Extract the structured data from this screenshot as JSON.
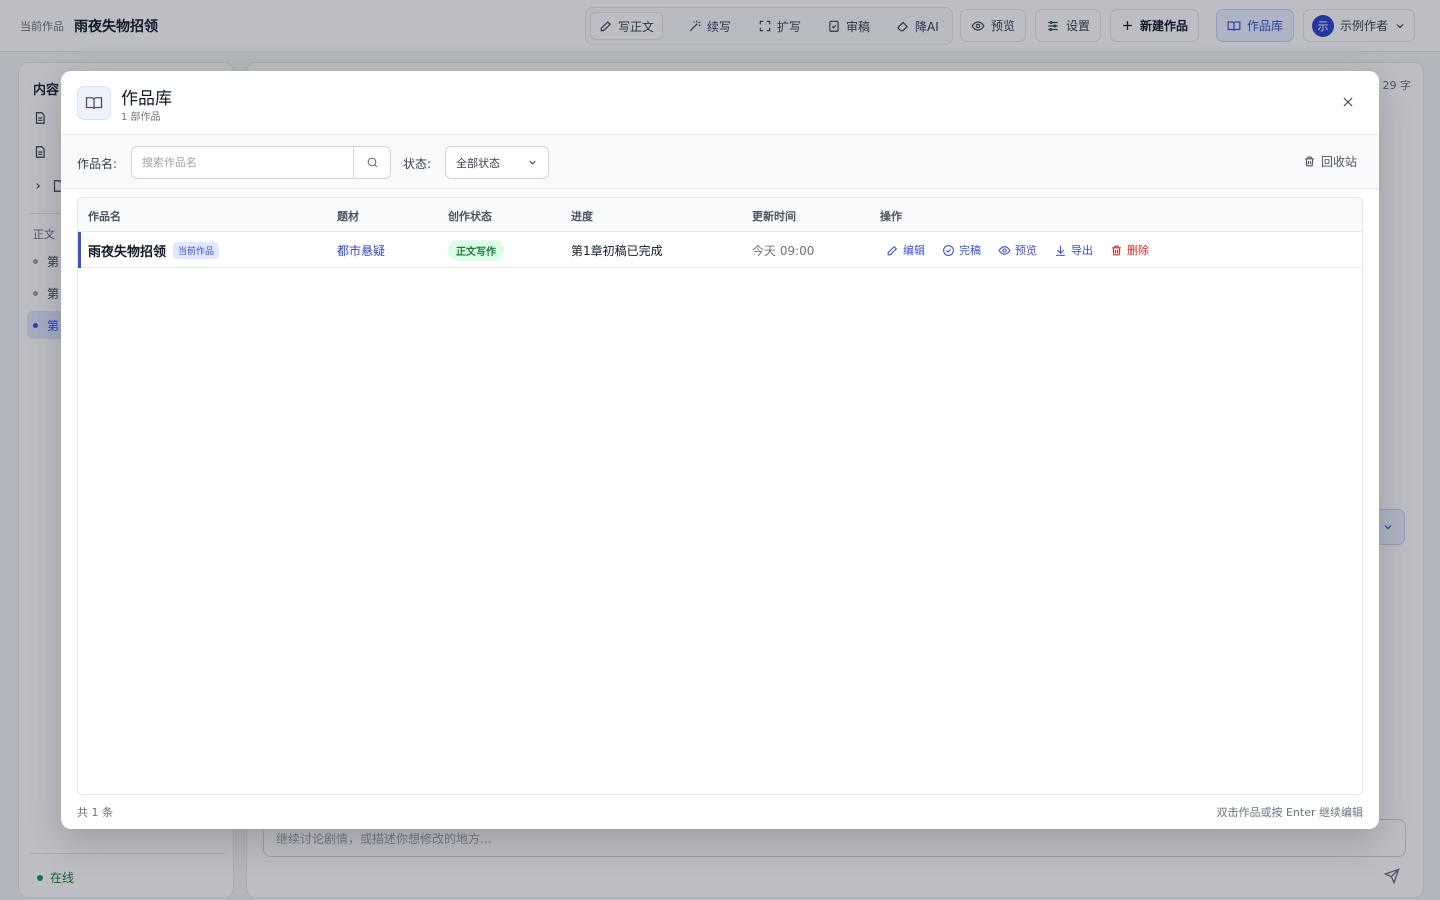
{
  "topbar": {
    "current_label": "当前作品",
    "current_title": "雨夜失物招领",
    "tools": [
      {
        "label": "写正文",
        "icon": "pencil-icon"
      },
      {
        "label": "续写",
        "icon": "magic-wand-icon"
      },
      {
        "label": "扩写",
        "icon": "expand-icon"
      },
      {
        "label": "审稿",
        "icon": "clipboard-check-icon"
      },
      {
        "label": "降AI",
        "icon": "eraser-icon"
      }
    ],
    "preview_label": "预览",
    "settings_label": "设置",
    "new_work_label": "新建作品",
    "library_label": "作品库",
    "user": {
      "avatar_text": "示",
      "name": "示例作者"
    }
  },
  "sidebar": {
    "heading": "内容",
    "section_label": "正文",
    "chapters": [
      "第",
      "第",
      "第"
    ],
    "status_label": "在线"
  },
  "main": {
    "word_count": "29 字",
    "chat_placeholder": "继续讨论剧情，或描述你想修改的地方..."
  },
  "modal": {
    "title": "作品库",
    "subtitle": "1 部作品",
    "filter": {
      "name_label": "作品名:",
      "search_placeholder": "搜索作品名",
      "status_label": "状态:",
      "status_value": "全部状态",
      "recycle_label": "回收站"
    },
    "columns": [
      "作品名",
      "题材",
      "创作状态",
      "进度",
      "更新时间",
      "操作"
    ],
    "rows": [
      {
        "name": "雨夜失物招领",
        "badge": "当前作品",
        "genre": "都市悬疑",
        "status": "正文写作",
        "progress": "第1章初稿已完成",
        "updated": "今天 09:00",
        "actions": {
          "edit": "编辑",
          "finish": "完稿",
          "preview": "预览",
          "export": "导出",
          "delete": "删除"
        }
      }
    ],
    "footer_total": "共 1 条",
    "footer_hint": "双击作品或按 Enter 继续编辑"
  },
  "colors": {
    "accent": "#3b4fd8",
    "success": "#15803d",
    "danger": "#dc2626"
  }
}
